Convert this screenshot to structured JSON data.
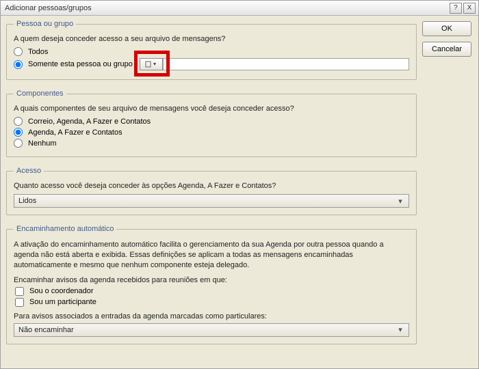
{
  "window": {
    "title": "Adicionar pessoas/grupos"
  },
  "buttons": {
    "ok": "OK",
    "cancel": "Cancelar",
    "help": "?",
    "close": "X"
  },
  "pessoa": {
    "legend": "Pessoa ou grupo",
    "question": "A quem deseja conceder acesso a seu arquivo de mensagens?",
    "opt_todos": "Todos",
    "opt_somente": "Somente esta pessoa ou grupo",
    "input_value": ""
  },
  "componentes": {
    "legend": "Componentes",
    "question": "A quais componentes de seu arquivo de mensagens você deseja conceder acesso?",
    "opt1": "Correio, Agenda, A Fazer e Contatos",
    "opt2": "Agenda, A Fazer e Contatos",
    "opt3": "Nenhum"
  },
  "acesso": {
    "legend": "Acesso",
    "question": "Quanto acesso você deseja conceder às opções Agenda, A Fazer e Contatos?",
    "select_value": "Lidos"
  },
  "encaminhamento": {
    "legend": "Encaminhamento automático",
    "descr": "A ativação do encaminhamento automático facilita o gerenciamento da sua Agenda por outra pessoa quando a agenda não está aberta e exibida. Essas definições se aplicam a todas as mensagens encaminhadas automaticamente e mesmo que nenhum componente esteja delegado.",
    "sub_encaminhar": "Encaminhar avisos da agenda recebidos para reuniões em que:",
    "chk_coordenador": "Sou o coordenador",
    "chk_participante": "Sou um participante",
    "sub_avisos": "Para avisos associados a entradas da agenda marcadas como particulares:",
    "select_value": "Não encaminhar"
  }
}
